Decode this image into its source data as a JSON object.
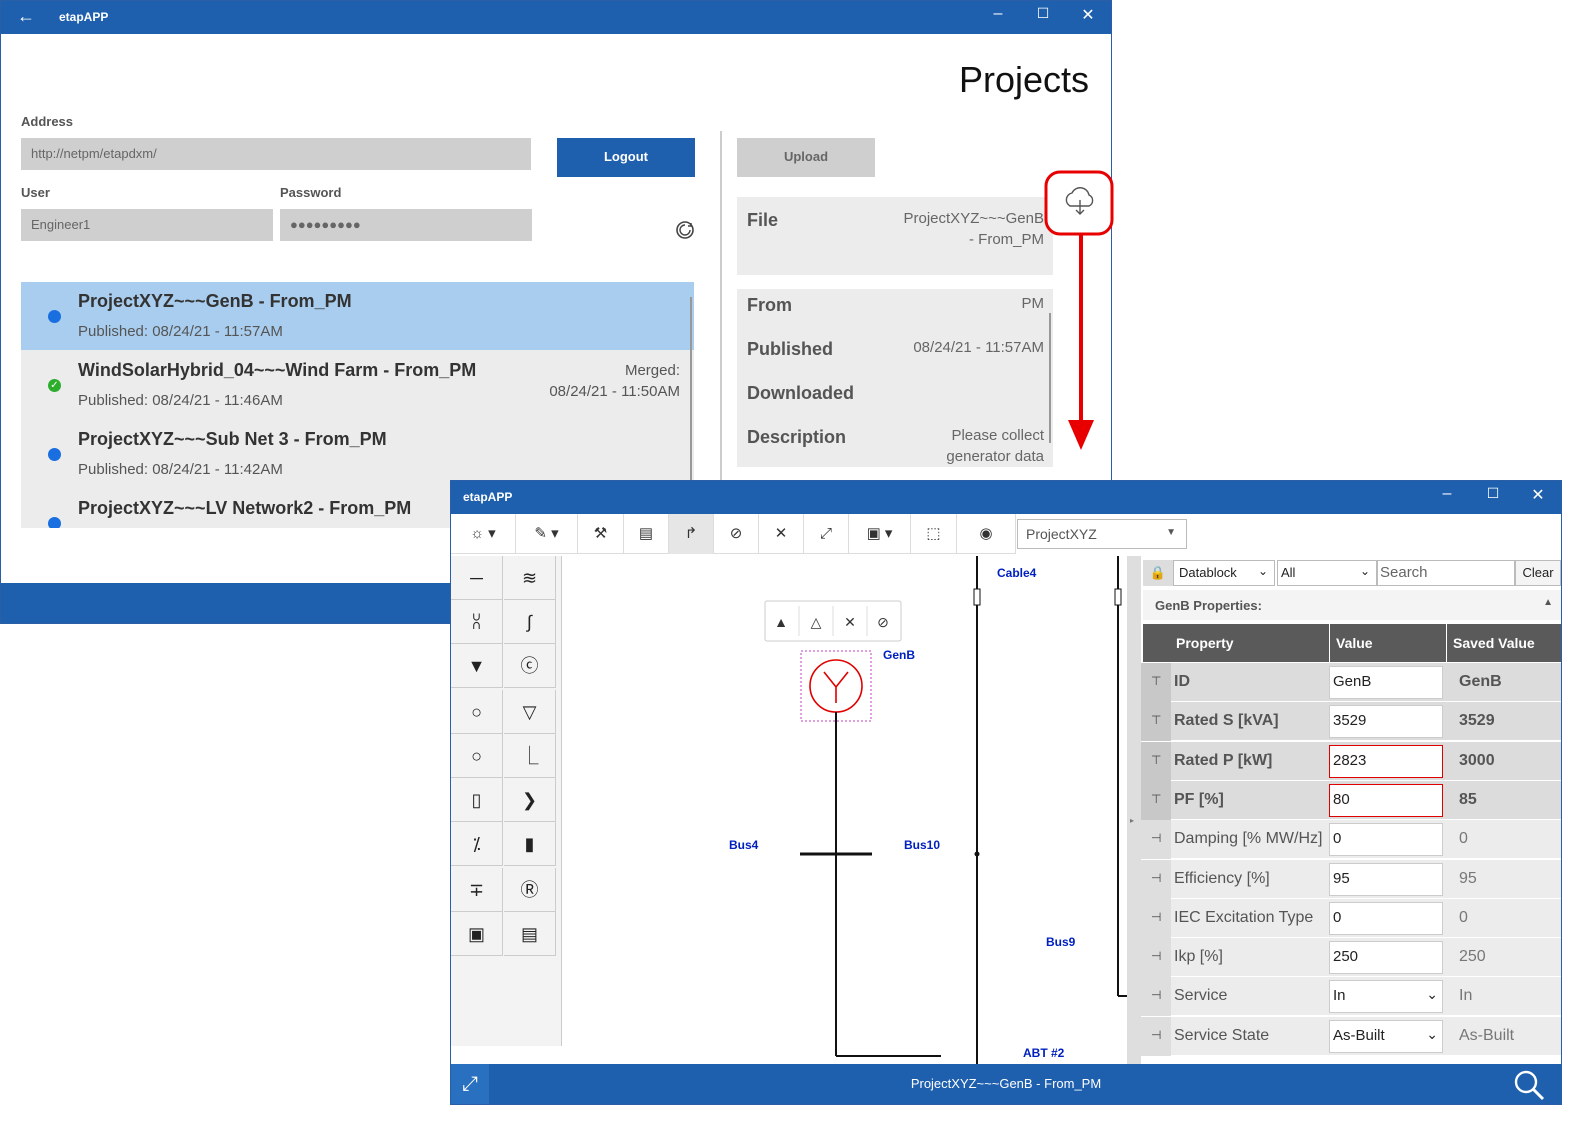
{
  "win1": {
    "title": "etapAPP",
    "page_title": "Projects",
    "address_label": "Address",
    "address_value": "http://netpm/etapdxm/",
    "user_label": "User",
    "user_value": "Engineer1",
    "password_label": "Password",
    "password_value": "●●●●●●●●●",
    "logout": "Logout",
    "upload": "Upload"
  },
  "projects": [
    {
      "name": "ProjectXYZ~~~GenB - From_PM",
      "published": "Published: 08/24/21 - 11:57AM",
      "merged": "",
      "status": "#1a6fe0"
    },
    {
      "name": "WindSolarHybrid_04~~~Wind Farm - From_PM",
      "published": "Published: 08/24/21 - 11:46AM",
      "merged": "Merged:\n08/24/21 - 11:50AM",
      "status": "#2cae2c"
    },
    {
      "name": "ProjectXYZ~~~Sub Net 3 - From_PM",
      "published": "Published: 08/24/21 - 11:42AM",
      "merged": "",
      "status": "#1a6fe0"
    },
    {
      "name": "ProjectXYZ~~~LV Network2 - From_PM",
      "published": "",
      "merged": "",
      "status": "#1a6fe0"
    }
  ],
  "details": {
    "file_label": "File",
    "file_value": "ProjectXYZ~~~GenB\n- From_PM",
    "from_label": "From",
    "from_value": "PM",
    "published_label": "Published",
    "published_value": "08/24/21 - 11:57AM",
    "downloaded_label": "Downloaded",
    "downloaded_value": "",
    "description_label": "Description",
    "description_value": "Please collect\ngenerator data"
  },
  "win2": {
    "title": "etapAPP",
    "project_select": "ProjectXYZ",
    "filter1": "Datablock",
    "filter2": "All",
    "search_placeholder": "Search",
    "clear": "Clear",
    "props_header": "GenB Properties:",
    "col_property": "Property",
    "col_value": "Value",
    "col_saved": "Saved Value",
    "status_text": "ProjectXYZ~~~GenB - From_PM"
  },
  "diagram": {
    "genb": "GenB",
    "bus4": "Bus4",
    "bus10": "Bus10",
    "cable4": "Cable4",
    "bus9": "Bus9",
    "abt2": "ABT #2"
  },
  "properties": [
    {
      "name": "ID",
      "value": "GenB",
      "saved": "GenB",
      "bold": true,
      "err": false,
      "select": false
    },
    {
      "name": "Rated S [kVA]",
      "value": "3529",
      "saved": "3529",
      "bold": true,
      "err": false,
      "select": false
    },
    {
      "name": "Rated P [kW]",
      "value": "2823",
      "saved": "3000",
      "bold": true,
      "err": true,
      "select": false
    },
    {
      "name": "PF [%]",
      "value": "80",
      "saved": "85",
      "bold": true,
      "err": true,
      "select": false
    },
    {
      "name": "Damping [% MW/Hz]",
      "value": "0",
      "saved": "0",
      "bold": false,
      "err": false,
      "select": false
    },
    {
      "name": "Efficiency [%]",
      "value": "95",
      "saved": "95",
      "bold": false,
      "err": false,
      "select": false
    },
    {
      "name": "IEC Excitation Type",
      "value": "0",
      "saved": "0",
      "bold": false,
      "err": false,
      "select": false
    },
    {
      "name": "Ikp [%]",
      "value": "250",
      "saved": "250",
      "bold": false,
      "err": false,
      "select": false
    },
    {
      "name": "Service",
      "value": "In",
      "saved": "In",
      "bold": false,
      "err": false,
      "select": true
    },
    {
      "name": "Service State",
      "value": "As-Built",
      "saved": "As-Built",
      "bold": false,
      "err": false,
      "select": true
    }
  ],
  "colors": {
    "brand": "#1e5fae",
    "selected_row": "#a9cdee",
    "error": "#e00000",
    "annotation": "#e80000"
  }
}
